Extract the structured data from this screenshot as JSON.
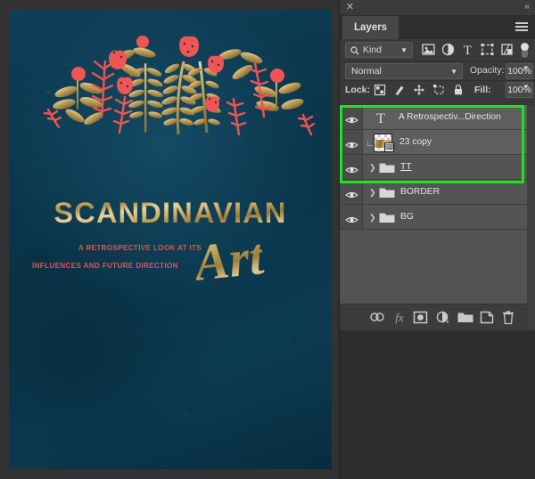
{
  "canvas": {
    "poster": {
      "title": "SCANDINAVIAN",
      "script_word": "Art",
      "subtitle_line1": "A RETROSPECTIVE LOOK AT ITS",
      "subtitle_line2": "INFLUENCES AND FUTURE DIRECTION",
      "background_color": "#0c3b52",
      "gold_color": "#c8a45c",
      "accent_red": "#e8504f"
    }
  },
  "panel": {
    "titlebar": {
      "close_icon": "close-icon",
      "collapse_icon": "double-chevron-left-icon"
    },
    "tab": {
      "label": "Layers",
      "menu_icon": "hamburger-menu-icon"
    },
    "filter": {
      "kind_label": "Kind",
      "search_icon": "search-icon",
      "caret_icon": "chevron-down-icon",
      "icons": [
        {
          "name": "filter-pixel-icon",
          "title": "Pixel layers"
        },
        {
          "name": "filter-adjustment-icon",
          "title": "Adjustment layers"
        },
        {
          "name": "filter-type-icon",
          "title": "Type layers"
        },
        {
          "name": "filter-shape-icon",
          "title": "Shape layers"
        },
        {
          "name": "filter-smartobject-icon",
          "title": "Smart objects"
        }
      ],
      "toggle_icon": "filter-toggle-switch"
    },
    "blend": {
      "mode": "Normal",
      "opacity_label": "Opacity:",
      "opacity_value": "100%"
    },
    "lock": {
      "label": "Lock:",
      "fill_label": "Fill:",
      "fill_value": "100%",
      "icons": [
        {
          "name": "lock-transparent-pixels-icon"
        },
        {
          "name": "lock-image-pixels-icon"
        },
        {
          "name": "lock-position-icon"
        },
        {
          "name": "lock-artboard-nesting-icon"
        },
        {
          "name": "lock-all-icon"
        }
      ]
    },
    "layers": [
      {
        "name": "A Retrospectiv...Direction",
        "kind": "type",
        "icon": "type-layer-T-icon",
        "visible": true,
        "selected": true,
        "underlined": false
      },
      {
        "name": "23 copy",
        "kind": "raster",
        "icon": "layer-thumbnail",
        "visible": true,
        "selected": true,
        "clipped": true,
        "badge": "smart-filter-badge",
        "underlined": false
      },
      {
        "name": "TT",
        "kind": "group",
        "icon": "folder-icon",
        "visible": true,
        "selected": false,
        "underlined": true,
        "expand_icon": "chevron-right-icon"
      },
      {
        "name": "BORDER",
        "kind": "group",
        "icon": "folder-icon",
        "visible": true,
        "selected": false,
        "underlined": false,
        "expand_icon": "chevron-right-icon"
      },
      {
        "name": "BG",
        "kind": "group",
        "icon": "folder-icon",
        "visible": true,
        "selected": false,
        "underlined": false,
        "expand_icon": "chevron-right-icon"
      }
    ],
    "toolbar": [
      {
        "name": "link-layers-button",
        "label": "link"
      },
      {
        "name": "layer-style-fx-button",
        "label": "fx"
      },
      {
        "name": "add-layer-mask-button",
        "label": "mask"
      },
      {
        "name": "new-adjustment-layer-button",
        "label": "adjustment"
      },
      {
        "name": "new-group-button",
        "label": "group"
      },
      {
        "name": "new-layer-button",
        "label": "new"
      },
      {
        "name": "delete-layer-button",
        "label": "delete"
      }
    ],
    "annotation": {
      "highlight_color": "#19e619"
    }
  }
}
